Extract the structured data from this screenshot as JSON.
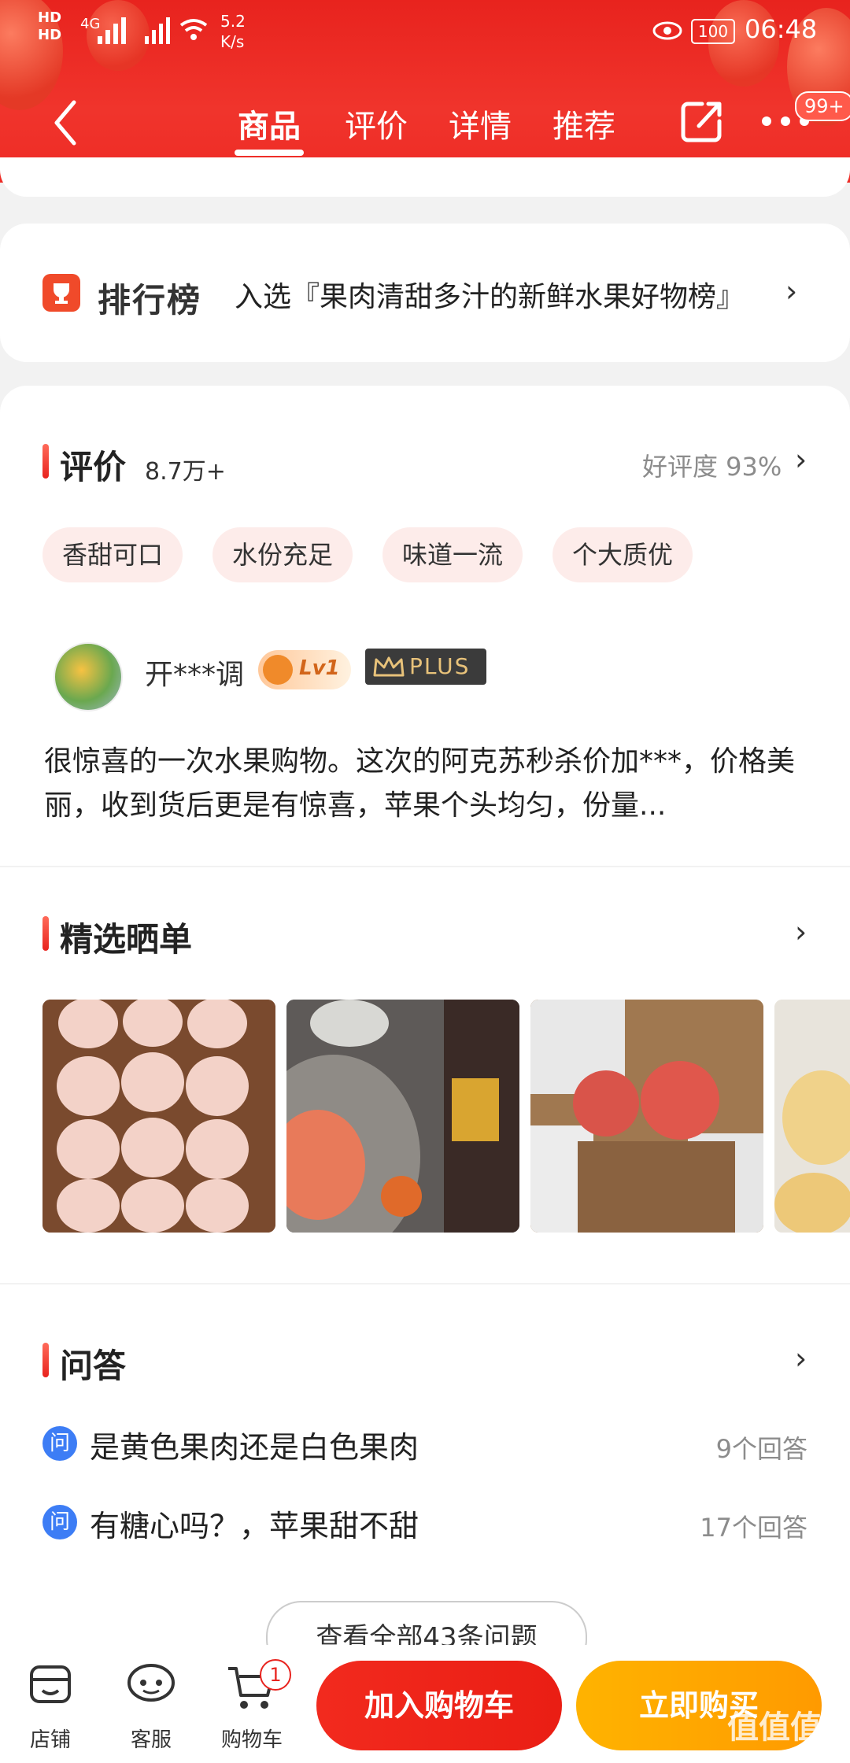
{
  "status_bar": {
    "network": "4G",
    "speed": "5.2\nK/s",
    "battery": "100",
    "time": "06:48"
  },
  "header": {
    "tabs": [
      "商品",
      "评价",
      "详情",
      "推荐"
    ],
    "active_tab": "商品",
    "more_badge": "99+"
  },
  "ranking": {
    "title": "排行榜",
    "text": "入选『果肉清甜多汁的新鲜水果好物榜』"
  },
  "reviews": {
    "title": "评价",
    "count": "8.7万+",
    "rating": "好评度 93%",
    "tags": [
      "香甜可口",
      "水份充足",
      "味道一流",
      "个大质优"
    ],
    "user": {
      "name": "开***调",
      "level": "Lv1",
      "plus": "PLUS"
    },
    "text": "很惊喜的一次水果购物。这次的阿克苏秒杀价加***，价格美丽，收到货后更是有惊喜，苹果个头均匀，份量..."
  },
  "gallery": {
    "title": "精选晒单"
  },
  "qa": {
    "title": "问答",
    "icon": "问",
    "items": [
      {
        "question": "是黄色果肉还是白色果肉",
        "answers": "9个回答"
      },
      {
        "question": "有糖心吗？，苹果甜不甜",
        "answers": "17个回答"
      }
    ],
    "view_all": "查看全部43条问题"
  },
  "bottom": {
    "store": "店铺",
    "service": "客服",
    "cart": "购物车",
    "cart_badge": "1",
    "add_to_cart": "加入购物车",
    "buy_now": "立即购买",
    "watermark": "值值值"
  }
}
